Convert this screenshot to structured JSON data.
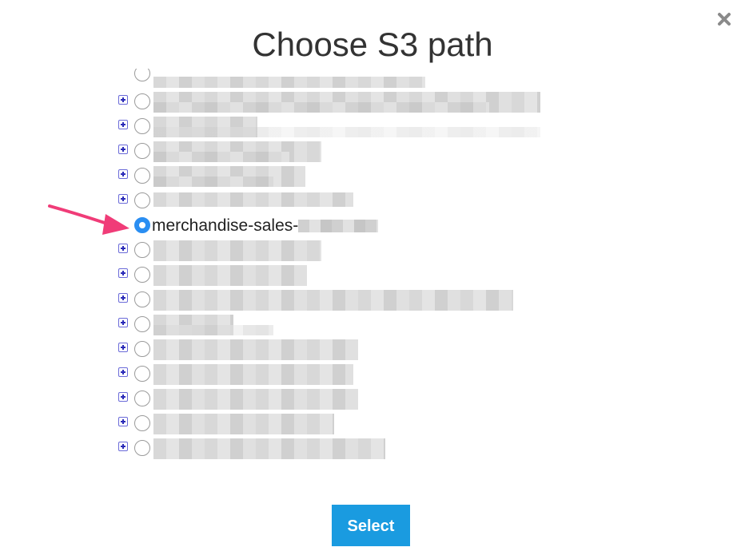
{
  "dialog": {
    "title": "Choose S3 path",
    "close_icon": "close-icon",
    "select_label": "Select"
  },
  "tree": {
    "selected_label": "merchandise-sales-",
    "rows": [
      {
        "label": "",
        "selected": false
      },
      {
        "label": "",
        "selected": false
      },
      {
        "label": "",
        "selected": false
      },
      {
        "label": "",
        "selected": false
      },
      {
        "label": "",
        "selected": false
      },
      {
        "label": "merchandise-sales-",
        "selected": true
      },
      {
        "label": "",
        "selected": false
      },
      {
        "label": "",
        "selected": false
      },
      {
        "label": "",
        "selected": false
      },
      {
        "label": "",
        "selected": false
      },
      {
        "label": "",
        "selected": false
      },
      {
        "label": "",
        "selected": false
      },
      {
        "label": "",
        "selected": false
      },
      {
        "label": "",
        "selected": false
      },
      {
        "label": "",
        "selected": false
      }
    ]
  },
  "colors": {
    "accent": "#1a9be0",
    "radio_selected": "#2a8ef2",
    "arrow": "#f03c78",
    "expand_icon": "#2b2bb8"
  }
}
